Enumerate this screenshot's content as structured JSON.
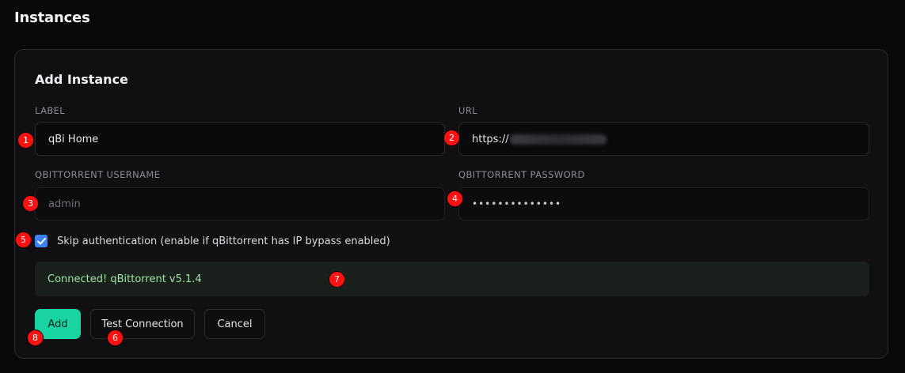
{
  "page": {
    "title": "Instances"
  },
  "form": {
    "title": "Add Instance",
    "label": {
      "label": "LABEL",
      "value": "qBi Home"
    },
    "url": {
      "label": "URL",
      "value_prefix": "https://"
    },
    "username": {
      "label": "QBITTORRENT USERNAME",
      "placeholder": "admin"
    },
    "password": {
      "label": "QBITTORRENT PASSWORD",
      "value": "••••••••••••••"
    },
    "skip_auth": {
      "label": "Skip authentication (enable if qBittorrent has IP bypass enabled)",
      "checked": true
    },
    "status": {
      "text": "Connected! qBittorrent v5.1.4"
    },
    "buttons": {
      "add": "Add",
      "test": "Test Connection",
      "cancel": "Cancel"
    }
  },
  "markers": [
    "1",
    "2",
    "3",
    "4",
    "5",
    "6",
    "7",
    "8"
  ],
  "colors": {
    "accent": "#19d3a2",
    "checkbox": "#3b82f6",
    "success_text": "#9fe3a6",
    "marker": "#ff1111"
  }
}
